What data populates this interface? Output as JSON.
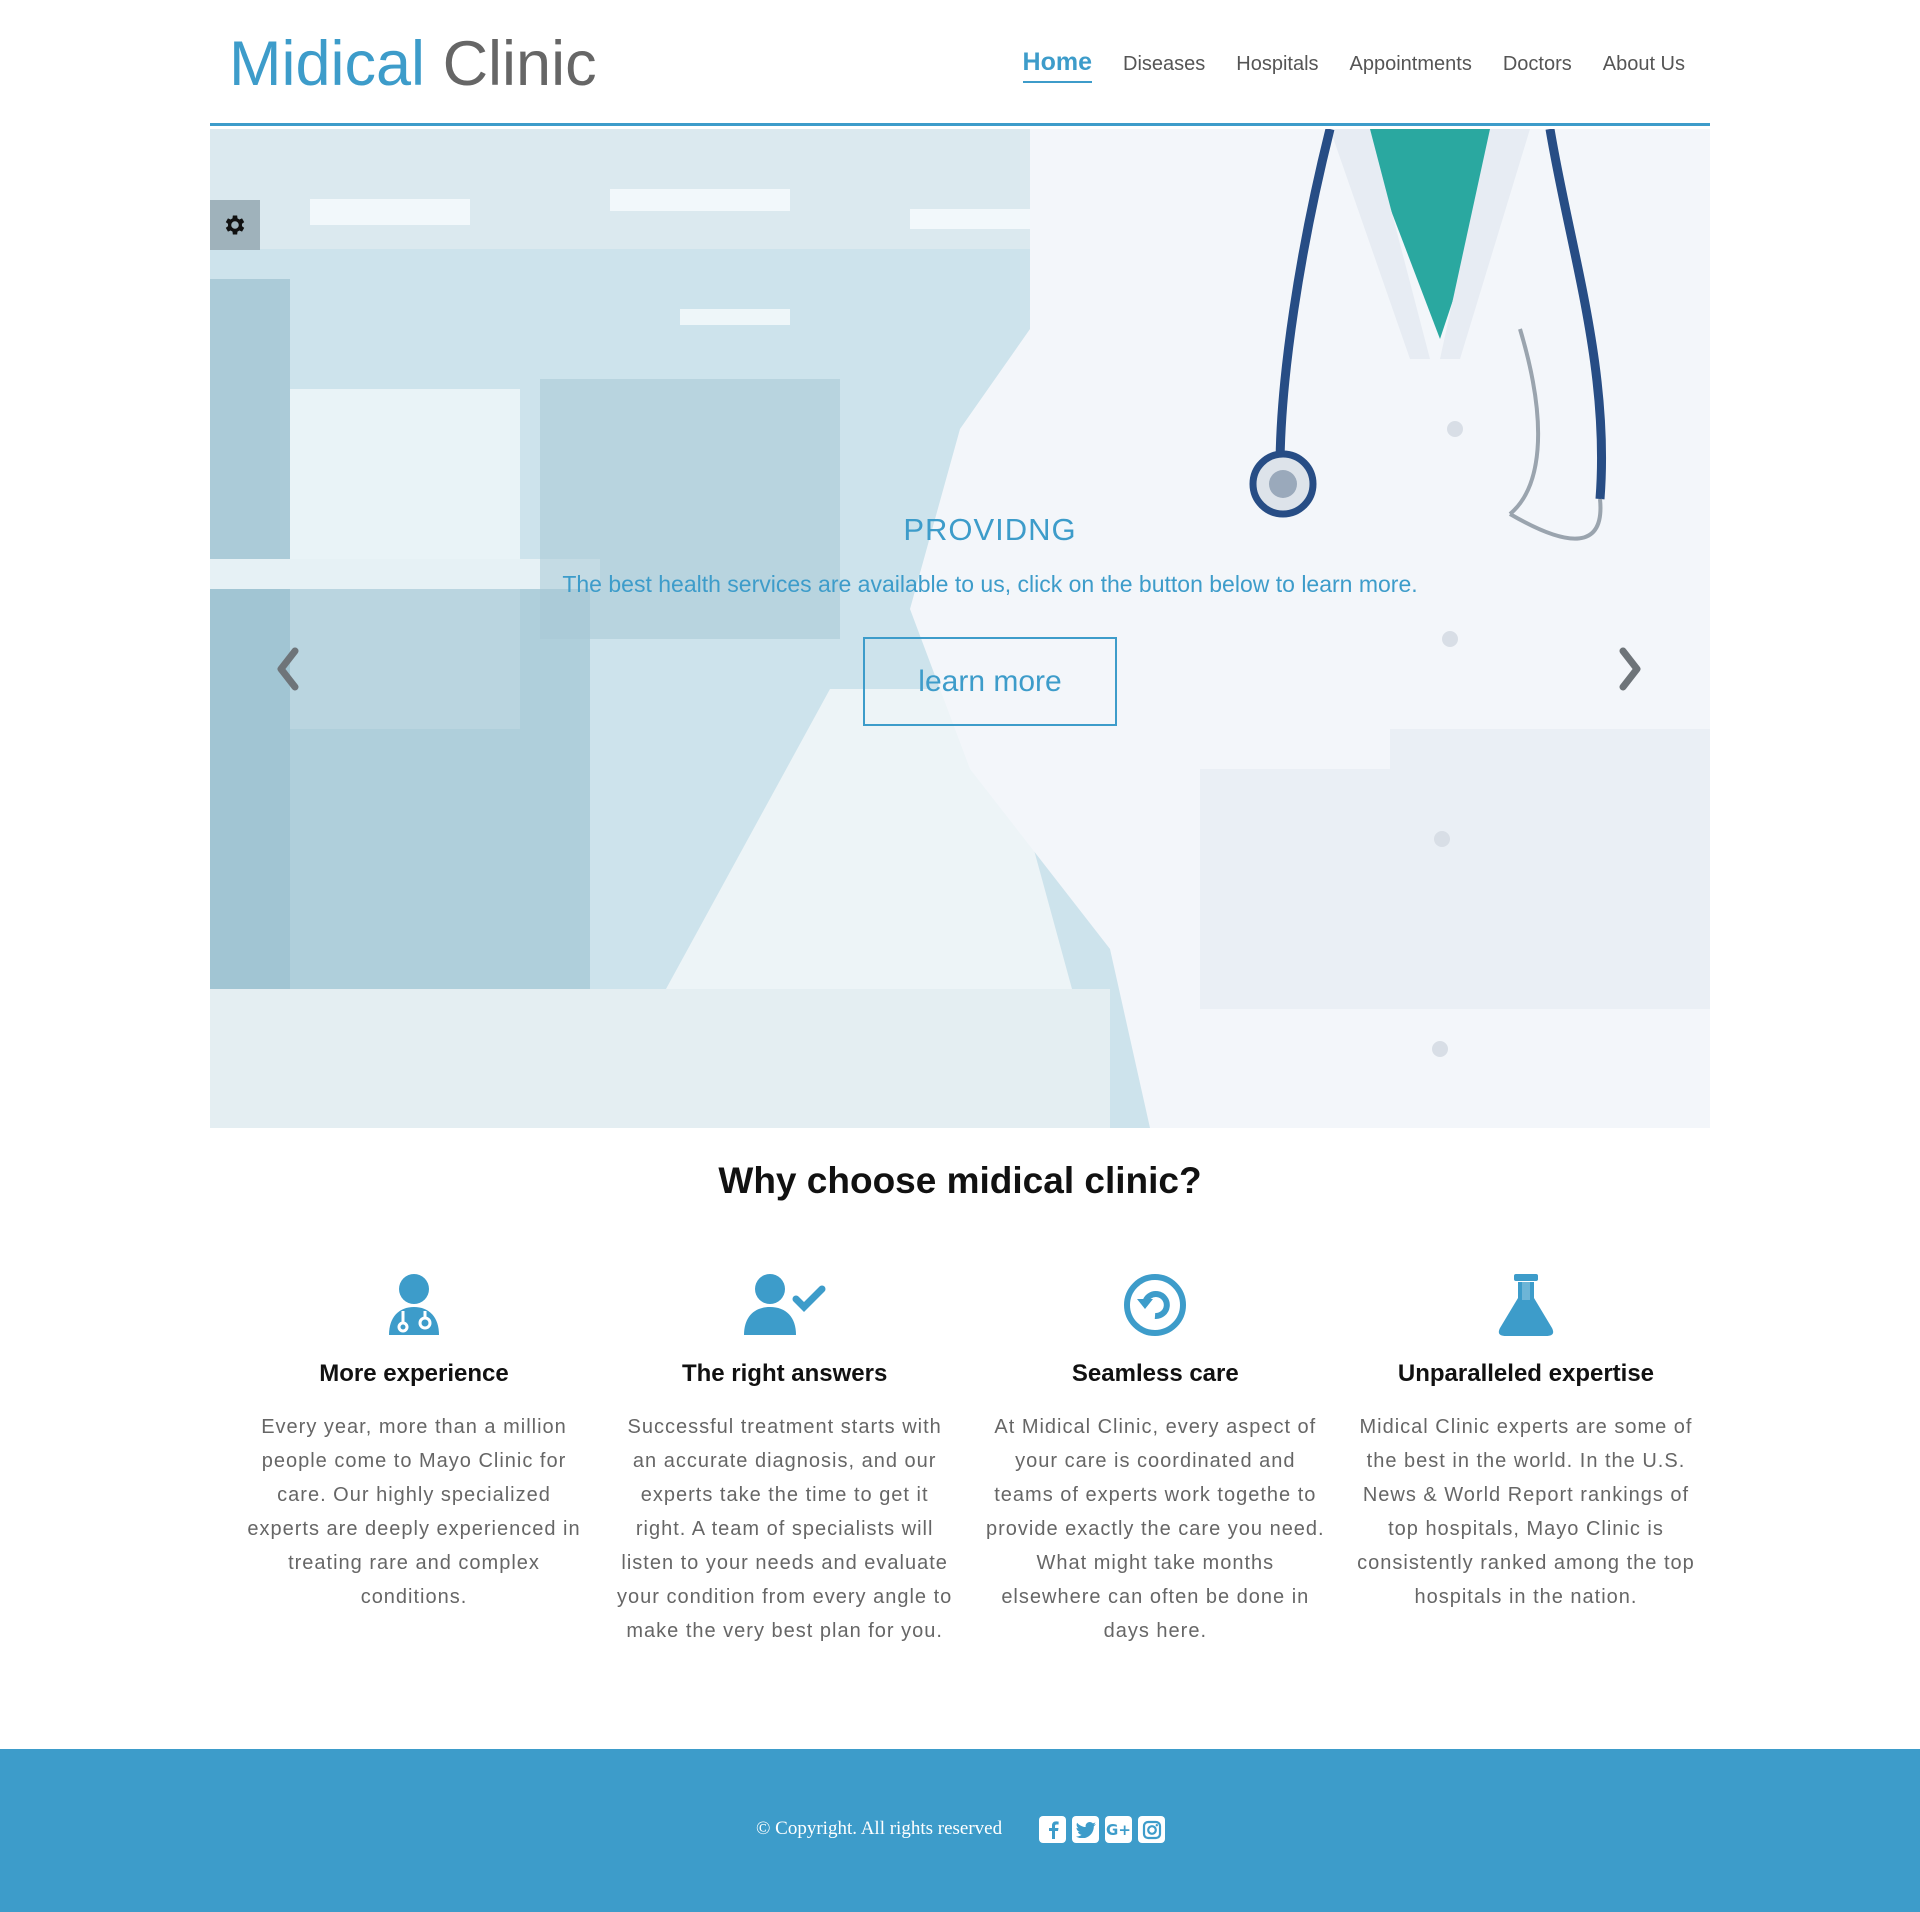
{
  "header": {
    "logo_part1": "Midical",
    "logo_part2": "Clinic",
    "nav": [
      "Home",
      "Diseases",
      "Hospitals",
      "Appointments",
      "Doctors",
      "About Us"
    ],
    "active_nav": "Home"
  },
  "hero": {
    "title": "PROVIDNG",
    "subtitle": "The best health services are available to us, click on the button below to learn more.",
    "button_label": "learn more"
  },
  "features": {
    "heading": "Why choose midical clinic?",
    "items": [
      {
        "icon": "doctor-icon",
        "title": "More experience",
        "text": "Every year, more than a million people come to Mayo Clinic for care. Our highly specialized experts are deeply experienced in treating rare and complex conditions."
      },
      {
        "icon": "user-check-icon",
        "title": "The right answers",
        "text": "Successful treatment starts with an accurate diagnosis, and our experts take the time to get it right. A team of specialists will listen to your needs and evaluate your condition from every angle to make the very best plan for you."
      },
      {
        "icon": "circle-arrow-icon",
        "title": "Seamless care",
        "text": "At Midical Clinic, every aspect of your care is coordinated and teams of experts work togethe to provide exactly the care you need. What might take months elsewhere can often be done in days here."
      },
      {
        "icon": "flask-icon",
        "title": "Unparalleled expertise",
        "text": "Midical Clinic experts are some of the best in the world. In the U.S. News & World Report rankings of top hospitals, Mayo Clinic is consistently ranked among the top hospitals in the nation."
      }
    ]
  },
  "footer": {
    "copyright": "© Copyright. All rights reserved",
    "social": [
      "facebook-icon",
      "twitter-icon",
      "google-plus-icon",
      "instagram-icon"
    ],
    "google_plus_glyph": "G+"
  },
  "colors": {
    "accent": "#3d9cca",
    "text_muted": "#666666"
  }
}
